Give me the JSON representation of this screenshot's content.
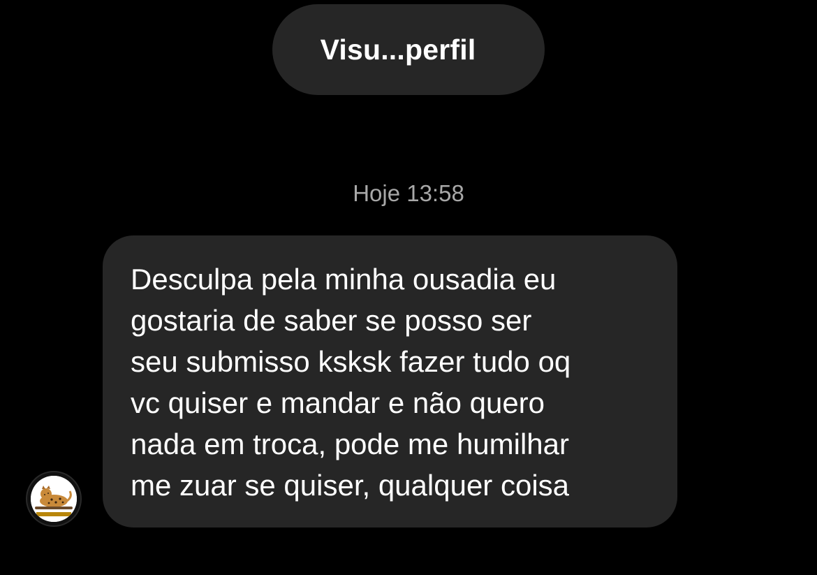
{
  "header": {
    "profile_button_label": "Visu...perfil"
  },
  "conversation": {
    "timestamp": "Hoje 13:58",
    "messages": [
      {
        "text": "Desculpa pela minha ousadia eu\ngostaria de saber se posso ser\nseu submisso ksksk fazer tudo oq\nvc quiser e mandar e não quero\nnada em troca, pode me humilhar\nme zuar se quiser, qualquer coisa",
        "sender_avatar_icon": "leopard-avatar-icon"
      }
    ]
  },
  "colors": {
    "background": "#000000",
    "bubble": "#262626",
    "text": "#ffffff",
    "timestamp": "#a8a8a8"
  }
}
